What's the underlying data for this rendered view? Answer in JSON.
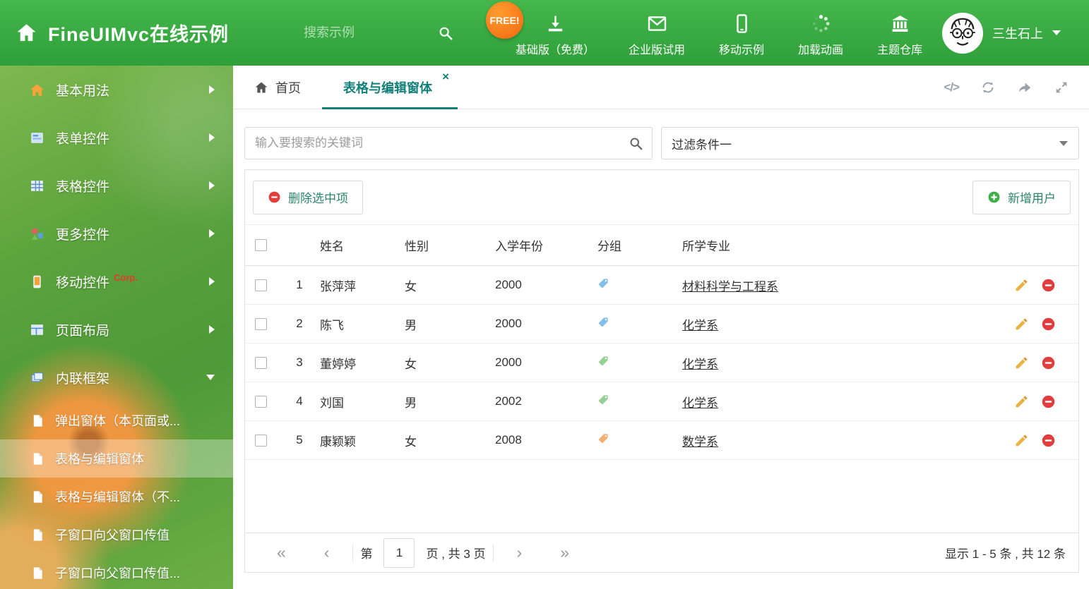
{
  "theme": {
    "header_green": "#3aac43",
    "accent_teal": "#13807a",
    "button_text_green": "#2c8569",
    "free_badge_orange": "#f4670f",
    "delete_red": "#e23d3d",
    "add_green": "#3fae49",
    "pencil_yellow": "#e4a93c"
  },
  "header": {
    "title": "FineUIMvc在线示例",
    "search_placeholder": "搜索示例",
    "free_badge": "FREE!",
    "nav": [
      {
        "label": "基础版（免费）",
        "icon": "download-icon"
      },
      {
        "label": "企业版试用",
        "icon": "envelope-icon"
      },
      {
        "label": "移动示例",
        "icon": "mobile-icon"
      },
      {
        "label": "加载动画",
        "icon": "spinner-icon"
      },
      {
        "label": "主题仓库",
        "icon": "bank-icon"
      }
    ],
    "user_name": "三生石上"
  },
  "sidebar": {
    "items": [
      {
        "label": "基本用法"
      },
      {
        "label": "表单控件"
      },
      {
        "label": "表格控件"
      },
      {
        "label": "更多控件"
      },
      {
        "label": "移动控件",
        "badge": "Corp."
      },
      {
        "label": "页面布局"
      },
      {
        "label": "内联框架"
      }
    ],
    "subitems": [
      {
        "label": "弹出窗体（本页面或..."
      },
      {
        "label": "表格与编辑窗体"
      },
      {
        "label": "表格与编辑窗体（不..."
      },
      {
        "label": "子窗口向父窗口传值"
      },
      {
        "label": "子窗口向父窗口传值..."
      }
    ]
  },
  "tabs": {
    "home_label": "首页",
    "active_label": "表格与编辑窗体",
    "close_glyph": "×",
    "code_glyph": "</>"
  },
  "filter": {
    "search_placeholder": "输入要搜索的关键词",
    "dropdown_value": "过滤条件一"
  },
  "toolbar": {
    "delete_label": "删除选中项",
    "add_label": "新增用户"
  },
  "table": {
    "columns": {
      "name": "姓名",
      "gender": "性别",
      "year": "入学年份",
      "group": "分组",
      "major": "所学专业"
    },
    "rows": [
      {
        "index": "1",
        "name": "张萍萍",
        "gender": "女",
        "year": "2000",
        "tag_color": "#85bfe9",
        "major": "材料科学与工程系"
      },
      {
        "index": "2",
        "name": "陈飞",
        "gender": "男",
        "year": "2000",
        "tag_color": "#85bfe9",
        "major": "化学系"
      },
      {
        "index": "3",
        "name": "董婷婷",
        "gender": "女",
        "year": "2000",
        "tag_color": "#97cf97",
        "major": "化学系"
      },
      {
        "index": "4",
        "name": "刘国",
        "gender": "男",
        "year": "2002",
        "tag_color": "#97cf97",
        "major": "化学系"
      },
      {
        "index": "5",
        "name": "康颖颖",
        "gender": "女",
        "year": "2008",
        "tag_color": "#f2b077",
        "major": "数学系"
      }
    ]
  },
  "pagination": {
    "first_glyph": "«",
    "prev_glyph": "‹",
    "next_glyph": "›",
    "last_glyph": "»",
    "page_prefix": "第",
    "current_page": "1",
    "page_suffix": "页 , 共 3 页",
    "summary": "显示 1 - 5 条 , 共 12 条"
  }
}
